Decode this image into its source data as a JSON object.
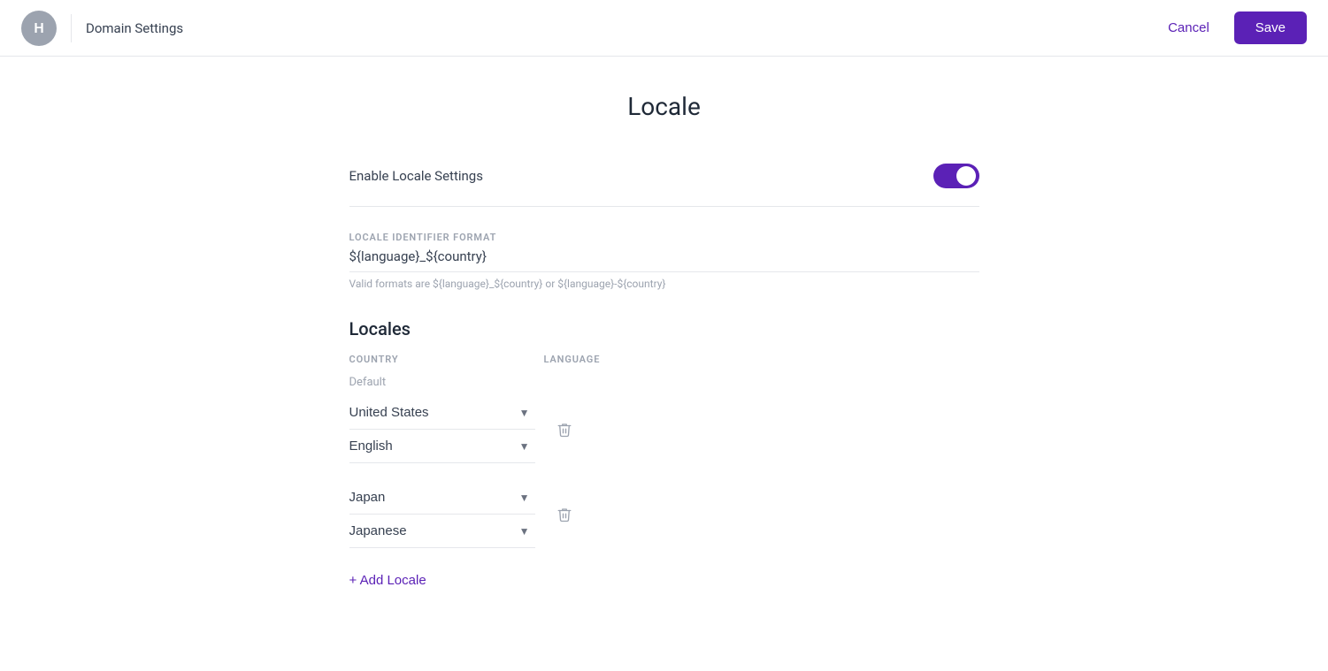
{
  "header": {
    "avatar_letter": "H",
    "title": "Domain Settings",
    "cancel_label": "Cancel",
    "save_label": "Save"
  },
  "page": {
    "title": "Locale"
  },
  "enable_locale": {
    "label": "Enable Locale Settings",
    "enabled": true
  },
  "locale_identifier": {
    "label": "LOCALE IDENTIFIER FORMAT",
    "value": "${language}_${country}",
    "hint": "Valid formats are ${language}_${country} or ${language}-${country}"
  },
  "locales_section": {
    "title": "Locales",
    "country_col": "COUNTRY",
    "language_col": "LANGUAGE",
    "rows": [
      {
        "group": "Default",
        "country": "United States",
        "language": "English"
      },
      {
        "group": "",
        "country": "Japan",
        "language": "Japanese"
      }
    ],
    "add_label": "+ Add Locale"
  }
}
